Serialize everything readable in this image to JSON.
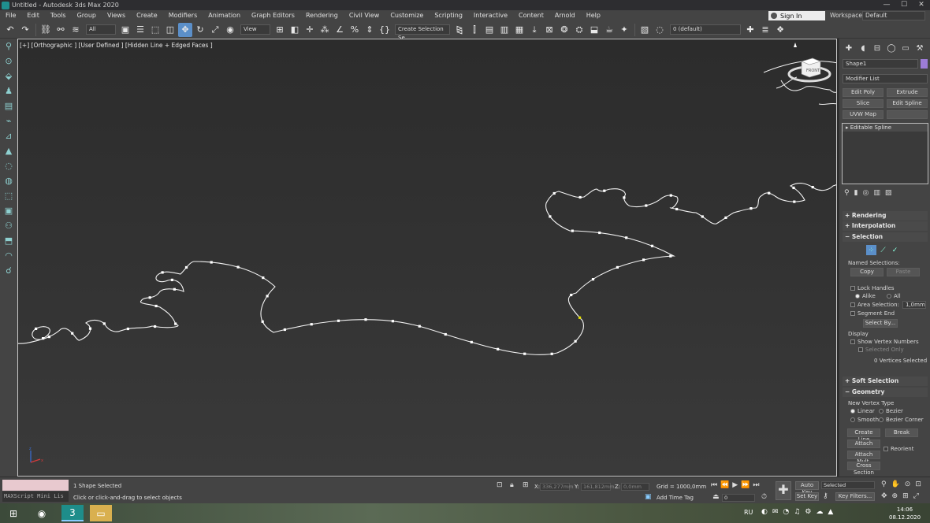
{
  "window": {
    "title": "Untitled - Autodesk 3ds Max 2020",
    "min": "—",
    "max": "☐",
    "close": "✕"
  },
  "menu": {
    "items": [
      "File",
      "Edit",
      "Tools",
      "Group",
      "Views",
      "Create",
      "Modifiers",
      "Animation",
      "Graph Editors",
      "Rendering",
      "Civil View",
      "Customize",
      "Scripting",
      "Interactive",
      "Content",
      "Arnold",
      "Help"
    ],
    "sign_in": "Sign In",
    "workspaces_label": "Workspaces:",
    "workspaces_value": "Default"
  },
  "toolbar": {
    "filter_select": "All",
    "ref_coord": "View",
    "selection_set": "Create Selection Se",
    "layer_select": "0 (default)"
  },
  "viewport": {
    "label": "[+] [Orthographic ] [User Defined ] [Hidden Line + Edged Faces ]",
    "viewcube_text": "FRONT"
  },
  "command_panel": {
    "object_name": "Shape1",
    "object_color": "#9c7cd6",
    "modifier_list": "Modifier List",
    "mod_buttons": [
      "Edit Poly",
      "Extrude",
      "Slice",
      "Edit Spline",
      "UVW Map",
      ""
    ],
    "stack_item": "Editable Spline",
    "rollouts": {
      "rendering": "Rendering",
      "interpolation": "Interpolation",
      "selection": "Selection",
      "soft_selection": "Soft Selection",
      "geometry": "Geometry"
    },
    "selection": {
      "named_selections": "Named Selections:",
      "copy": "Copy",
      "paste": "Paste",
      "lock_handles": "Lock Handles",
      "alike": "Alike",
      "all": "All",
      "area_selection": "Area Selection:",
      "area_value": "1,0mm",
      "segment_end": "Segment End",
      "select_by": "Select By...",
      "display": "Display",
      "show_vertex_numbers": "Show Vertex Numbers",
      "selected_only": "Selected Only",
      "vertices_selected": "0 Vertices Selected"
    },
    "geometry": {
      "new_vertex_type": "New Vertex Type",
      "linear": "Linear",
      "bezier": "Bezier",
      "smooth": "Smooth",
      "bezier_corner": "Bezier Corner",
      "create_line": "Create Line",
      "break": "Break",
      "attach": "Attach",
      "reorient": "Reorient",
      "attach_mult": "Attach Mult.",
      "cross_section": "Cross Section"
    }
  },
  "status": {
    "maxscript": "MAXScript Mini Lis",
    "selection_status": "1 Shape Selected",
    "prompt": "Click or click-and-drag to select objects",
    "x_label": "X:",
    "x_value": "336,277mm",
    "y_label": "Y:",
    "y_value": "161,812mm",
    "z_label": "Z:",
    "z_value": "0,0mm",
    "grid": "Grid = 1000,0mm",
    "add_time_tag": "Add Time Tag",
    "frame": "0",
    "auto_key": "Auto Key",
    "set_key": "Set Key",
    "selected": "Selected",
    "key_filters": "Key Filters..."
  },
  "taskbar": {
    "max_icon": "3",
    "lang": "RU",
    "time": "14:06",
    "date": "08.12.2020"
  }
}
